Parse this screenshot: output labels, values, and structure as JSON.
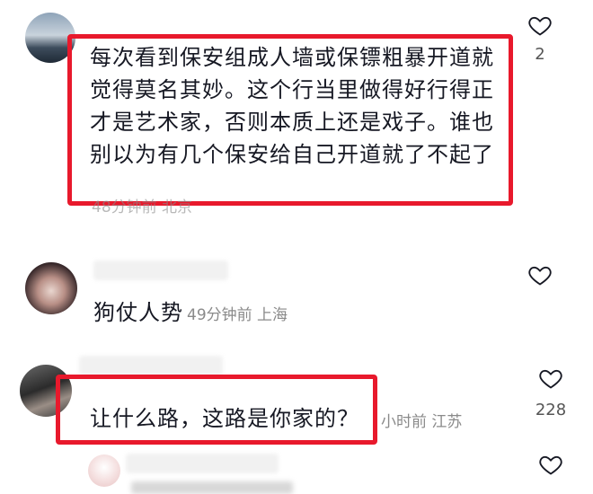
{
  "comments": [
    {
      "text": "每次看到保安组成人墙或保镖粗暴开道就觉得莫名其妙。这个行当里做得好行得正才是艺术家，否则本质上还是戏子。谁也别以为有几个保安给自己开道就了不起了",
      "meta": "48分钟前 北京",
      "likes": "2"
    },
    {
      "text": "狗仗人势",
      "meta": "49分钟前 上海",
      "likes": ""
    },
    {
      "text": "让什么路，这路是你家的？",
      "meta": "小时前 江苏",
      "likes": "228"
    }
  ],
  "colors": {
    "highlight": "#e8192c",
    "meta": "#8a8a8a",
    "text": "#161823"
  },
  "icons": {
    "like": "heart-outline-icon"
  }
}
